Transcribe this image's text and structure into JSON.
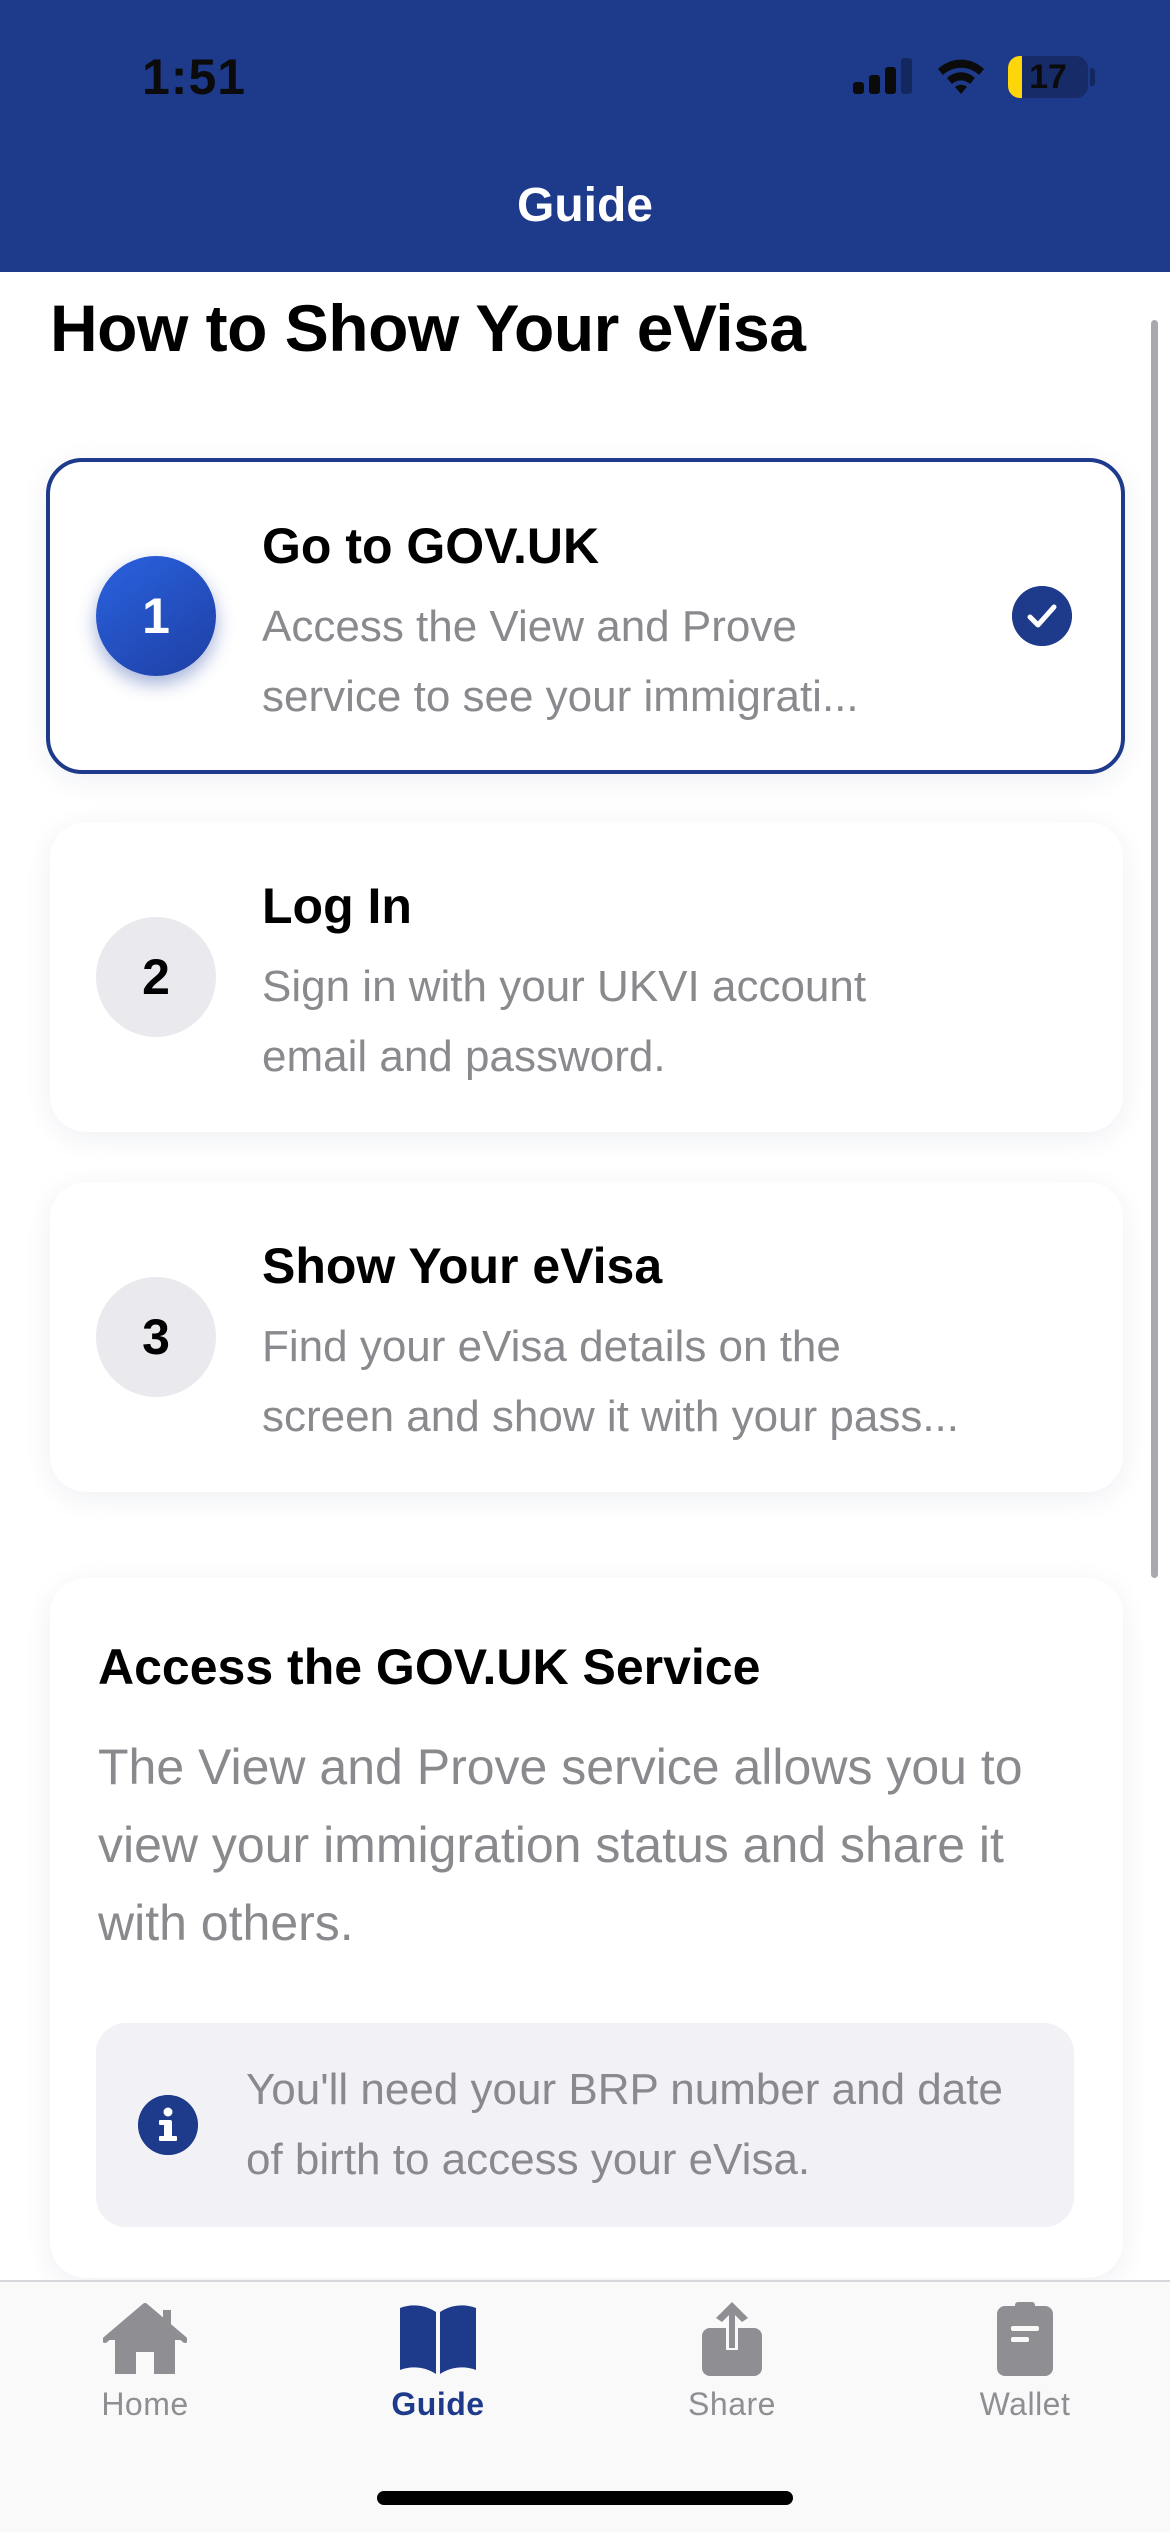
{
  "status_bar": {
    "time": "1:51",
    "battery": "17",
    "battery_level": 0.17
  },
  "nav": {
    "title": "Guide"
  },
  "page": {
    "title": "How to Show Your eVisa"
  },
  "steps": [
    {
      "number": "1",
      "title": "Go to GOV.UK",
      "description": "Access the View and Prove\nservice to see your immigrati...",
      "active": true,
      "completed": true
    },
    {
      "number": "2",
      "title": "Log In",
      "description": "Sign in with your UKVI account\nemail and password.",
      "active": false,
      "completed": false
    },
    {
      "number": "3",
      "title": "Show Your eVisa",
      "description": "Find your eVisa details on the\nscreen and show it with your pass...",
      "active": false,
      "completed": false
    }
  ],
  "detail": {
    "title": "Access the GOV.UK Service",
    "body": "The View and Prove service allows you to view your immigration status and share it with others.",
    "note": "You'll need your BRP number and date of birth to access your eVisa."
  },
  "tabs": [
    {
      "label": "Home",
      "icon": "house-icon",
      "active": false
    },
    {
      "label": "Guide",
      "icon": "book-icon",
      "active": true
    },
    {
      "label": "Share",
      "icon": "share-icon",
      "active": false
    },
    {
      "label": "Wallet",
      "icon": "wallet-icon",
      "active": false
    }
  ],
  "colors": {
    "brand": "#1e3a8a",
    "accent_gradient_start": "#2a62e0",
    "muted_text": "#8a8a8e",
    "inactive_tab": "#8e8e93"
  }
}
